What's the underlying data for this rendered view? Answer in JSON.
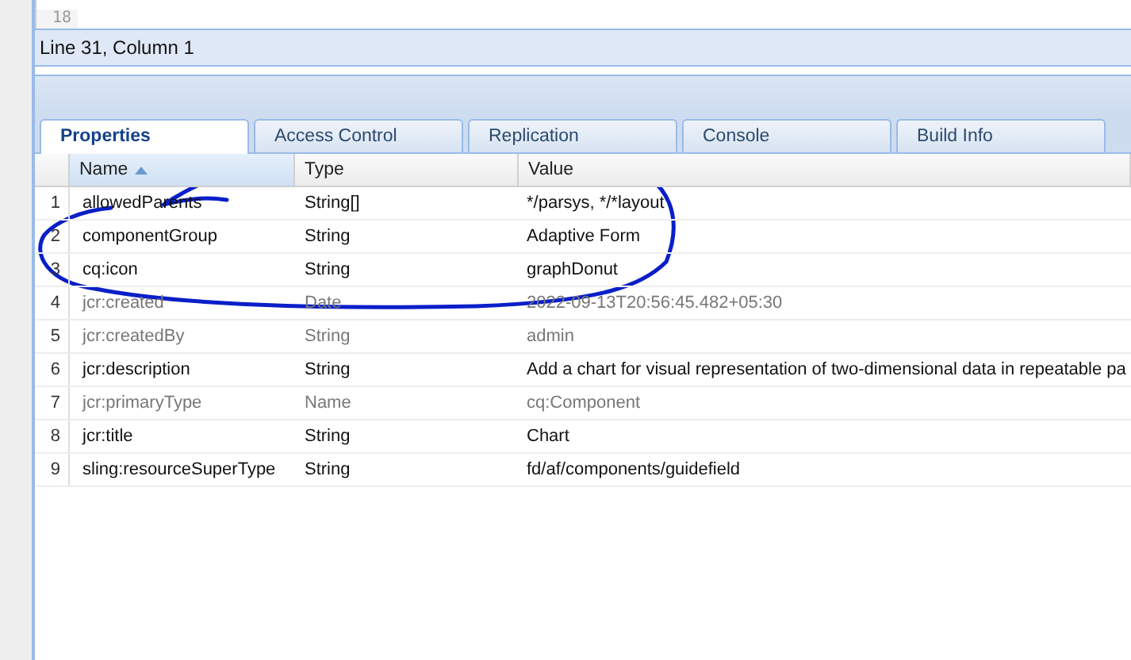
{
  "editor": {
    "lines": [
      {
        "number": "18"
      }
    ]
  },
  "status_bar": "Line 31, Column 1",
  "tabs": [
    {
      "label": "Properties",
      "selected": true
    },
    {
      "label": "Access Control",
      "selected": false
    },
    {
      "label": "Replication",
      "selected": false
    },
    {
      "label": "Console",
      "selected": false
    },
    {
      "label": "Build Info",
      "selected": false
    }
  ],
  "table": {
    "columns": [
      "Name",
      "Type",
      "Value"
    ],
    "rows": [
      {
        "index": "1",
        "name": "allowedParents",
        "type": "String[]",
        "value": "*/parsys, */*layout",
        "protected": false
      },
      {
        "index": "2",
        "name": "componentGroup",
        "type": "String",
        "value": "Adaptive Form",
        "protected": false
      },
      {
        "index": "3",
        "name": "cq:icon",
        "type": "String",
        "value": "graphDonut",
        "protected": false
      },
      {
        "index": "4",
        "name": "jcr:created",
        "type": "Date",
        "value": "2022-09-13T20:56:45.482+05:30",
        "protected": true
      },
      {
        "index": "5",
        "name": "jcr:createdBy",
        "type": "String",
        "value": "admin",
        "protected": true
      },
      {
        "index": "6",
        "name": "jcr:description",
        "type": "String",
        "value": "Add a chart for visual representation of two-dimensional data in repeatable pa",
        "protected": false
      },
      {
        "index": "7",
        "name": "jcr:primaryType",
        "type": "Name",
        "value": "cq:Component",
        "protected": true
      },
      {
        "index": "8",
        "name": "jcr:title",
        "type": "String",
        "value": "Chart",
        "protected": false
      },
      {
        "index": "9",
        "name": "sling:resourceSuperType",
        "type": "String",
        "value": "fd/af/components/guidefield",
        "protected": false
      }
    ]
  }
}
